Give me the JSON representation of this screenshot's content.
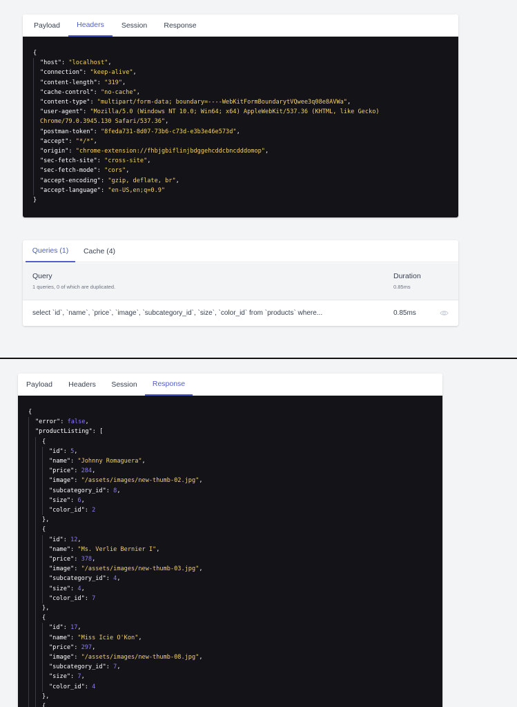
{
  "panel1": {
    "tabs": [
      {
        "label": "Payload",
        "active": false
      },
      {
        "label": "Headers",
        "active": true
      },
      {
        "label": "Session",
        "active": false
      },
      {
        "label": "Response",
        "active": false
      }
    ],
    "headers": [
      [
        "host",
        "localhost"
      ],
      [
        "connection",
        "keep-alive"
      ],
      [
        "content-length",
        "319"
      ],
      [
        "cache-control",
        "no-cache"
      ],
      [
        "content-type",
        "multipart/form-data; boundary=----WebKitFormBoundarytVQwee3q08e8AVWa"
      ],
      [
        "user-agent",
        "Mozilla/5.0 (Windows NT 10.0; Win64; x64) AppleWebKit/537.36 (KHTML, like Gecko)",
        "Chrome/79.0.3945.130 Safari/537.36"
      ],
      [
        "postman-token",
        "8feda731-8d07-73b6-c73d-e3b3e46e573d"
      ],
      [
        "accept",
        "*/*"
      ],
      [
        "origin",
        "chrome-extension://fhbjgbiflinjbdggehcddcbncdddomop"
      ],
      [
        "sec-fetch-site",
        "cross-site"
      ],
      [
        "sec-fetch-mode",
        "cors"
      ],
      [
        "accept-encoding",
        "gzip, deflate, br"
      ],
      [
        "accept-language",
        "en-US,en;q=0.9"
      ]
    ]
  },
  "panel2": {
    "tabs": [
      {
        "label": "Queries (1)",
        "active": true
      },
      {
        "label": "Cache (4)",
        "active": false
      }
    ],
    "query_label": "Query",
    "query_summary": "1 queries, 0 of which are duplicated.",
    "duration_label": "Duration",
    "duration_total": "0.85ms",
    "row": {
      "sql": "select `id`, `name`, `price`, `image`, `subcategory_id`, `size`, `color_id` from `products` where...",
      "duration": "0.85ms",
      "icon": "eye-icon"
    }
  },
  "panel3": {
    "tabs": [
      {
        "label": "Payload",
        "active": false
      },
      {
        "label": "Headers",
        "active": false
      },
      {
        "label": "Session",
        "active": false
      },
      {
        "label": "Response",
        "active": true
      }
    ],
    "error_value": "false",
    "products": [
      {
        "id": "5",
        "name": "Johnny Romaguera",
        "price": "284",
        "image": "/assets/images/new-thumb-02.jpg",
        "subcategory_id": "8",
        "size": "6",
        "color_id": "2"
      },
      {
        "id": "12",
        "name": "Ms. Verlie Bernier I",
        "price": "378",
        "image": "/assets/images/new-thumb-03.jpg",
        "subcategory_id": "4",
        "size": "4",
        "color_id": "7"
      },
      {
        "id": "17",
        "name": "Miss Icie O'Kon",
        "price": "297",
        "image": "/assets/images/new-thumb-08.jpg",
        "subcategory_id": "7",
        "size": "7",
        "color_id": "4"
      }
    ]
  }
}
